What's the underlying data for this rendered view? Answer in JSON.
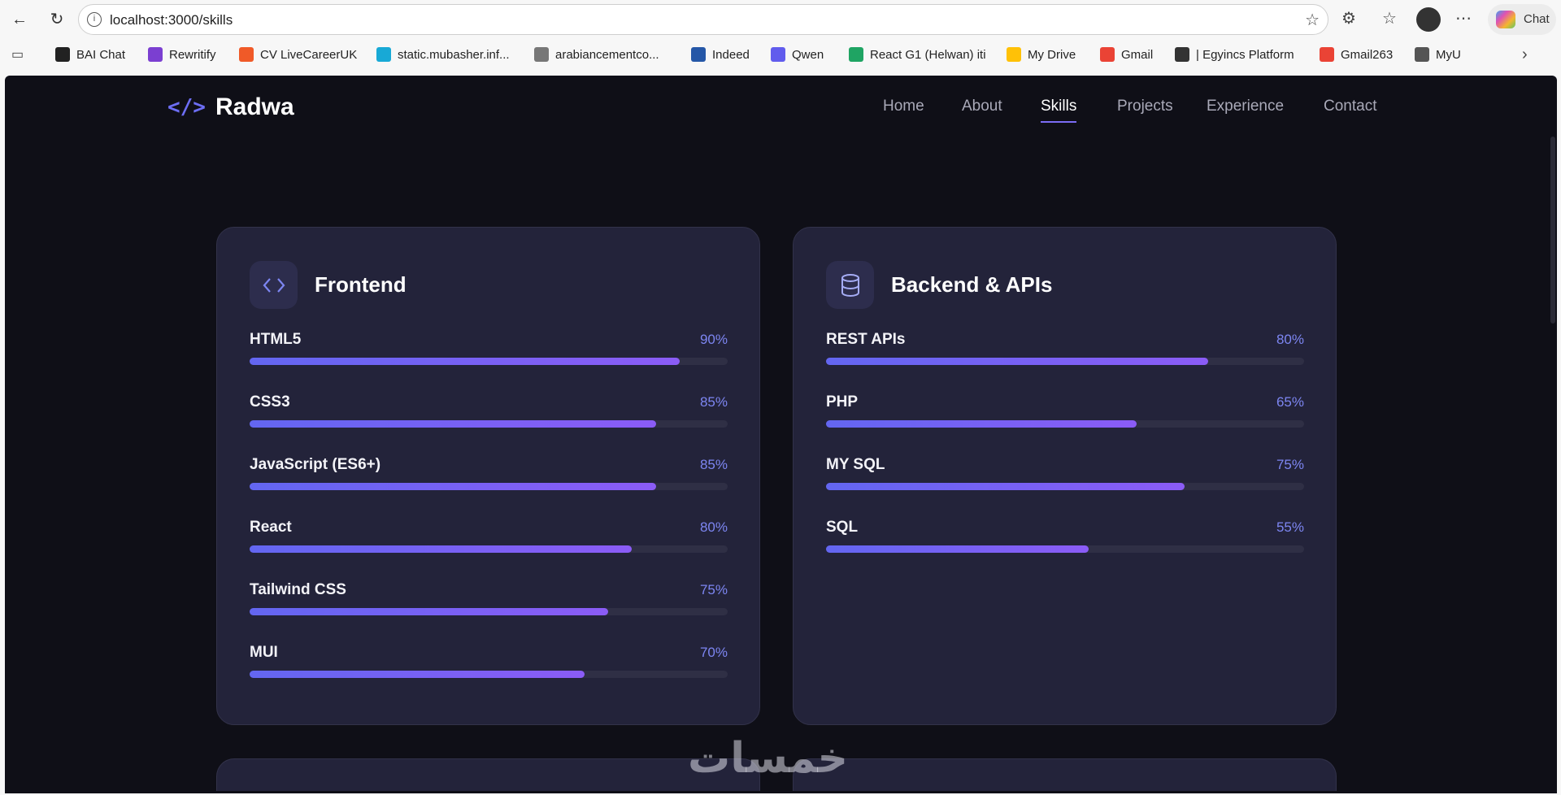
{
  "browser": {
    "url": "localhost:3000/skills",
    "chat_label": "Chat",
    "bookmarks": [
      {
        "label": "BAI Chat",
        "color": "#222"
      },
      {
        "label": "Rewritify",
        "color": "#7b3fd1"
      },
      {
        "label": "CV LiveCareerUK",
        "color": "#f05a28"
      },
      {
        "label": "static.mubasher.inf...",
        "color": "#18a9d6"
      },
      {
        "label": "arabiancementco...",
        "color": "#777"
      },
      {
        "label": "Indeed",
        "color": "#2557a7"
      },
      {
        "label": "Qwen",
        "color": "#615ced"
      },
      {
        "label": "React G1 (Helwan) iti",
        "color": "#1fa463"
      },
      {
        "label": "My Drive",
        "color": "#ffc107"
      },
      {
        "label": "Gmail",
        "color": "#ea4335"
      },
      {
        "label": "| Egyincs Platform",
        "color": "#333"
      },
      {
        "label": "Gmail263",
        "color": "#ea4335"
      },
      {
        "label": "MyU",
        "color": "#555"
      }
    ]
  },
  "site": {
    "logo_icon": "</>",
    "logo": "Radwa",
    "nav": [
      "Home",
      "About",
      "Skills",
      "Projects",
      "Experience",
      "Contact"
    ],
    "active_nav": "Skills"
  },
  "cards": [
    {
      "title": "Frontend",
      "icon": "code-icon",
      "skills": [
        {
          "name": "HTML5",
          "percent": 90,
          "label": "90%"
        },
        {
          "name": "CSS3",
          "percent": 85,
          "label": "85%"
        },
        {
          "name": "JavaScript (ES6+)",
          "percent": 85,
          "label": "85%"
        },
        {
          "name": "React",
          "percent": 80,
          "label": "80%"
        },
        {
          "name": "Tailwind CSS",
          "percent": 75,
          "label": "75%"
        },
        {
          "name": "MUI",
          "percent": 70,
          "label": "70%"
        }
      ]
    },
    {
      "title": "Backend & APIs",
      "icon": "database-icon",
      "skills": [
        {
          "name": "REST APIs",
          "percent": 80,
          "label": "80%"
        },
        {
          "name": "PHP",
          "percent": 65,
          "label": "65%"
        },
        {
          "name": "MY SQL",
          "percent": 75,
          "label": "75%"
        },
        {
          "name": "SQL",
          "percent": 55,
          "label": "55%"
        }
      ]
    }
  ],
  "watermark": "خمسات",
  "colors": {
    "accent": "#6366f1",
    "accent2": "#8b5cf6",
    "bg": "#0f0f17",
    "card": "#23233a"
  }
}
